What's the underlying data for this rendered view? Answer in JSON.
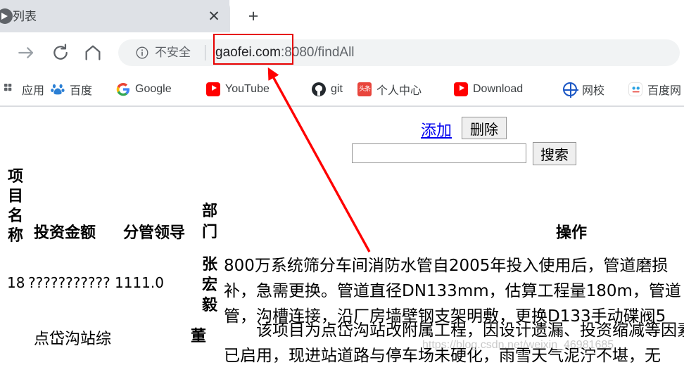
{
  "browser": {
    "tab": {
      "title": "列表",
      "favicon": "video-favicon",
      "close_label": "✕",
      "new_tab_label": "+"
    },
    "nav": {
      "forward_icon": "arrow-forward-icon",
      "reload_icon": "reload-icon",
      "home_icon": "home-icon"
    },
    "omnibox": {
      "info_icon": "info-circle-icon",
      "security_label": "不安全",
      "url_host": "gaofei.com",
      "url_rest": ":8080/findAll"
    },
    "bookmarks": [
      {
        "label": "应用",
        "icon": "apps-icon"
      },
      {
        "label": "百度",
        "icon": "baidu-icon"
      },
      {
        "label": "Google",
        "icon": "google-icon"
      },
      {
        "label": "YouTube",
        "icon": "youtube-icon"
      },
      {
        "label": "git",
        "icon": "github-icon"
      },
      {
        "label": "个人中心",
        "icon": "toutiao-icon"
      },
      {
        "label": "Download",
        "icon": "youtube-icon"
      },
      {
        "label": "网校",
        "icon": "globe-icon"
      },
      {
        "label": "百度网",
        "icon": "baidu-pan-icon"
      }
    ]
  },
  "page": {
    "controls": {
      "add_label": "添加",
      "delete_label": "删除",
      "search_value": "",
      "search_placeholder": "",
      "search_button_label": "搜索"
    },
    "table": {
      "headers": {
        "name": "项目名称",
        "amount": "投资金额",
        "leader": "分管领导",
        "department": "部门",
        "action": "操作"
      },
      "rows": [
        {
          "id": "18",
          "name": "???????????",
          "amount": "1111.0",
          "leader": "张宏毅",
          "description": "800万系统筛分车间消防水管自2005年投入使用后，管道磨损\n补，急需更换。管道直径DN133mm，估算工程量180m，管道\n管，沟槽连接，沿厂房墙壁钢支架明敷，更换D133手动碟阀5"
        },
        {
          "name": "点岱沟站综",
          "leader": "董",
          "description": "　　该项目为点岱沟站改附属工程，因设计遗漏、投资缩减等因素未\n已启用，现进站道路与停车场未硬化，雨雪天气泥泞不堪，无"
        }
      ]
    },
    "watermark": "https://blog.csdn.net/weixin_46981685"
  },
  "annotation": {
    "highlight_color": "#e60000",
    "arrow_color": "#ff0000",
    "arrow_from": "525,358",
    "arrow_to": "380,97"
  }
}
